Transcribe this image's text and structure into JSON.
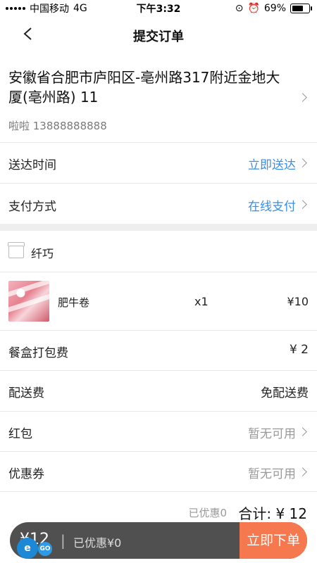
{
  "status_bar": {
    "carrier": "中国移动",
    "network": "4G",
    "time": "下午3:32",
    "battery": "69%",
    "battery_level": 0.69
  },
  "nav": {
    "title": "提交订单"
  },
  "address": {
    "text": "安徽省合肥市庐阳区-亳州路317附近金地大厦(亳州路) 11",
    "contact": "啦啦 13888888888"
  },
  "delivery_time": {
    "label": "送达时间",
    "value": "立即送达"
  },
  "payment": {
    "label": "支付方式",
    "value": "在线支付"
  },
  "shop": {
    "name": "纤巧"
  },
  "item": {
    "name": "肥牛卷",
    "qty": "x1",
    "price": "¥10"
  },
  "packing_fee": {
    "label": "餐盒打包费",
    "value": "¥ 2"
  },
  "delivery_fee": {
    "label": "配送费",
    "value": "免配送费"
  },
  "red_packet": {
    "label": "红包",
    "value": "暂无可用"
  },
  "coupon": {
    "label": "优惠券",
    "value": "暂无可用"
  },
  "summary": {
    "discount": "已优惠0",
    "total": "合计: ¥ 12"
  },
  "bottom_bar": {
    "price": "¥12",
    "separator": "|",
    "discount": "已优惠¥0",
    "submit": "立即下单"
  },
  "colors": {
    "accent_blue": "#3a8ee6",
    "submit_orange": "#f6784f",
    "bar_dark": "#505050"
  }
}
